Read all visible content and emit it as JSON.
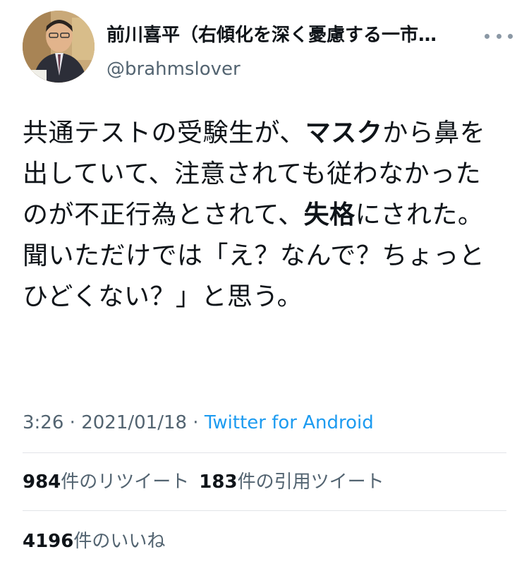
{
  "author": {
    "display_name": "前川喜平（右傾化を深く憂慮する一市…",
    "handle": "@brahmslover"
  },
  "tweet": {
    "body_segments": [
      {
        "text": "共通テストの受験生が、",
        "bold": false
      },
      {
        "text": "マスク",
        "bold": true
      },
      {
        "text": "から鼻を出していて、注意されても従わなかったのが不正行為とされて、",
        "bold": false
      },
      {
        "text": "失格",
        "bold": true
      },
      {
        "text": "にされた。聞いただけでは「え？なんで？ちょっとひどくない？」と思う。",
        "bold": false
      }
    ],
    "time": "3:26",
    "separator": " · ",
    "date": "2021/01/18",
    "source": "Twitter for Android"
  },
  "stats": {
    "retweets_count": "984",
    "retweets_label": "件のリツイート",
    "quotes_count": "183",
    "quotes_label": "件の引用ツイート",
    "likes_count": "4196",
    "likes_label": "件のいいね"
  },
  "colors": {
    "text": "#0f1419",
    "secondary": "#536471",
    "link": "#1d9bf0",
    "divider": "#e1e4e8"
  },
  "icons": {
    "more": "more-horizontal-icon"
  }
}
